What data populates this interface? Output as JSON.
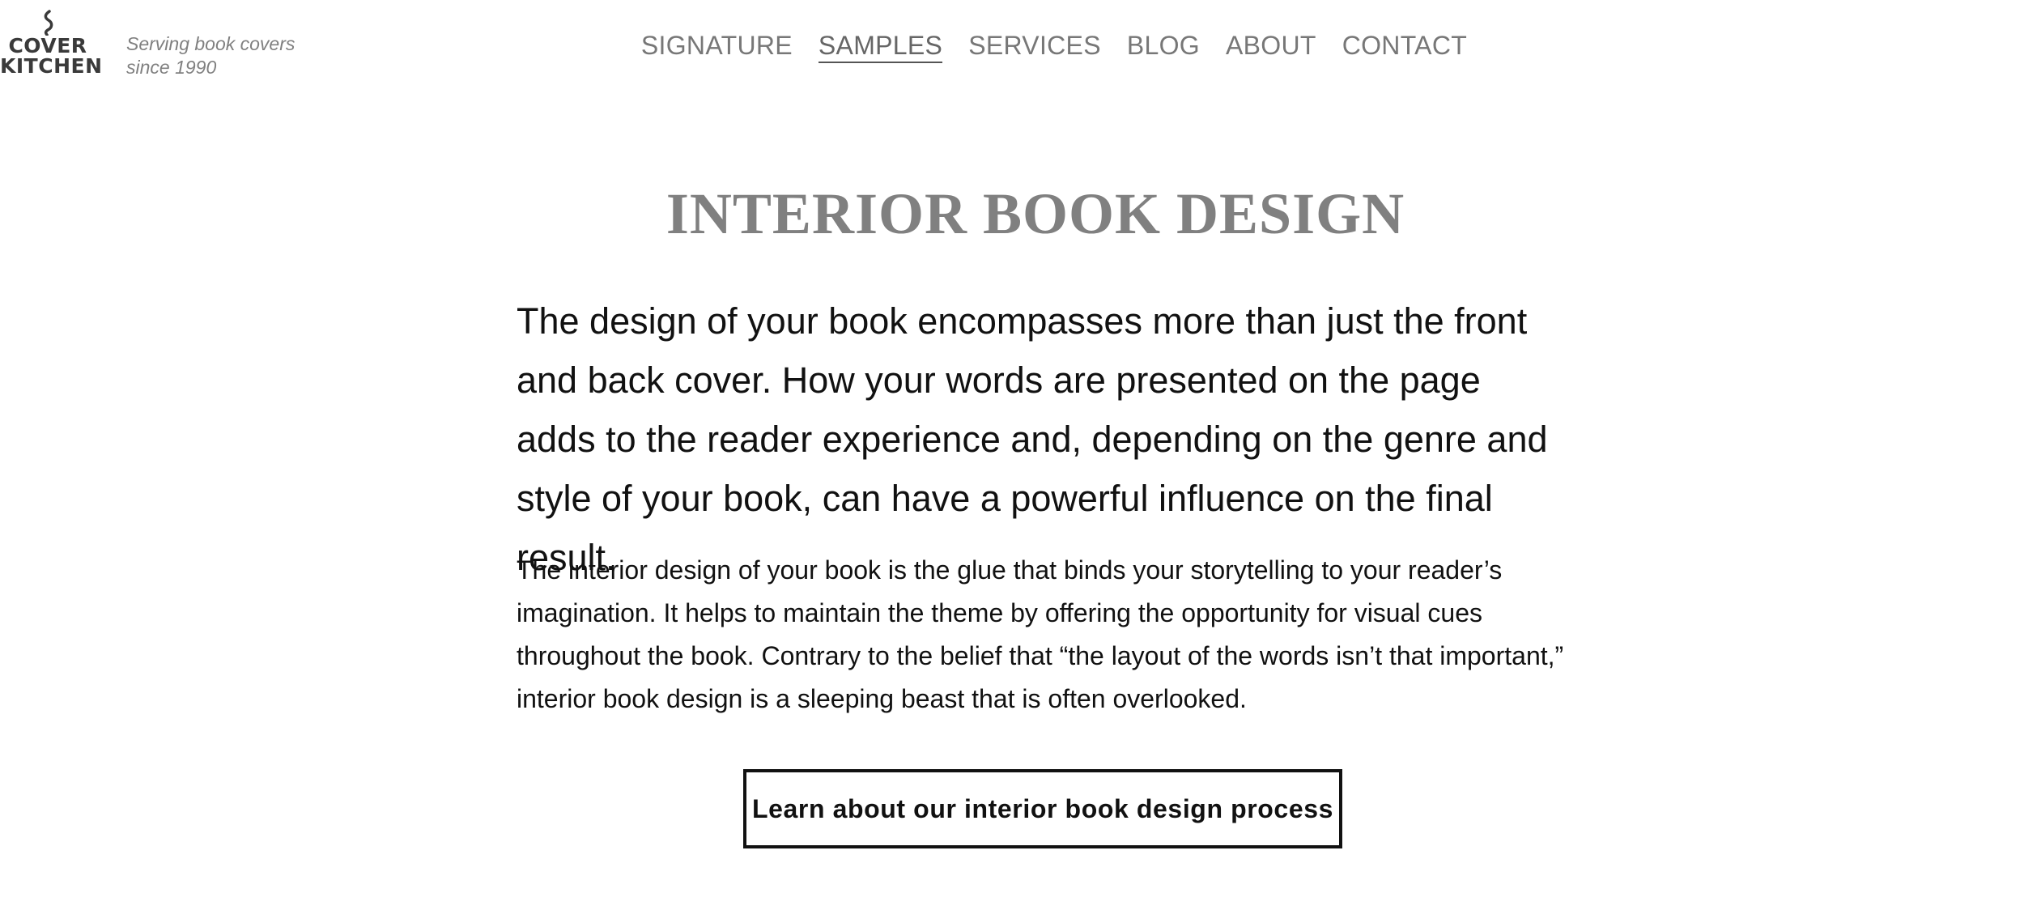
{
  "header": {
    "logo": {
      "icon": "steam-swirl-icon",
      "line1": "COVER",
      "line2": "KITCHEN"
    },
    "tagline": {
      "line1": "Serving book covers",
      "line2": "since 1990"
    },
    "nav": [
      {
        "label": "SIGNATURE",
        "active": false
      },
      {
        "label": "SAMPLES",
        "active": true
      },
      {
        "label": "SERVICES",
        "active": false
      },
      {
        "label": "BLOG",
        "active": false
      },
      {
        "label": "ABOUT",
        "active": false
      },
      {
        "label": "CONTACT",
        "active": false
      }
    ]
  },
  "main": {
    "title": "INTERIOR BOOK DESIGN",
    "lead": "The design of your book encompasses more than just the front and back cover. How your words are presented on the page adds to the reader experience and, depending on the genre and style of your book, can have a powerful influence on the final result.",
    "body": "The interior design of your book is the glue that binds your storytelling to your reader’s imagination. It helps to maintain the theme by offering the opportunity for visual cues throughout the book. Contrary to the belief that “the layout of the words isn’t that important,” interior book design is a sleeping beast that is often overlooked.",
    "cta_label": "Learn about our interior book design process"
  },
  "colors": {
    "background": "#ffffff",
    "nav_text": "#777777",
    "title": "#808080",
    "body_text": "#111111",
    "tagline": "#808080"
  }
}
